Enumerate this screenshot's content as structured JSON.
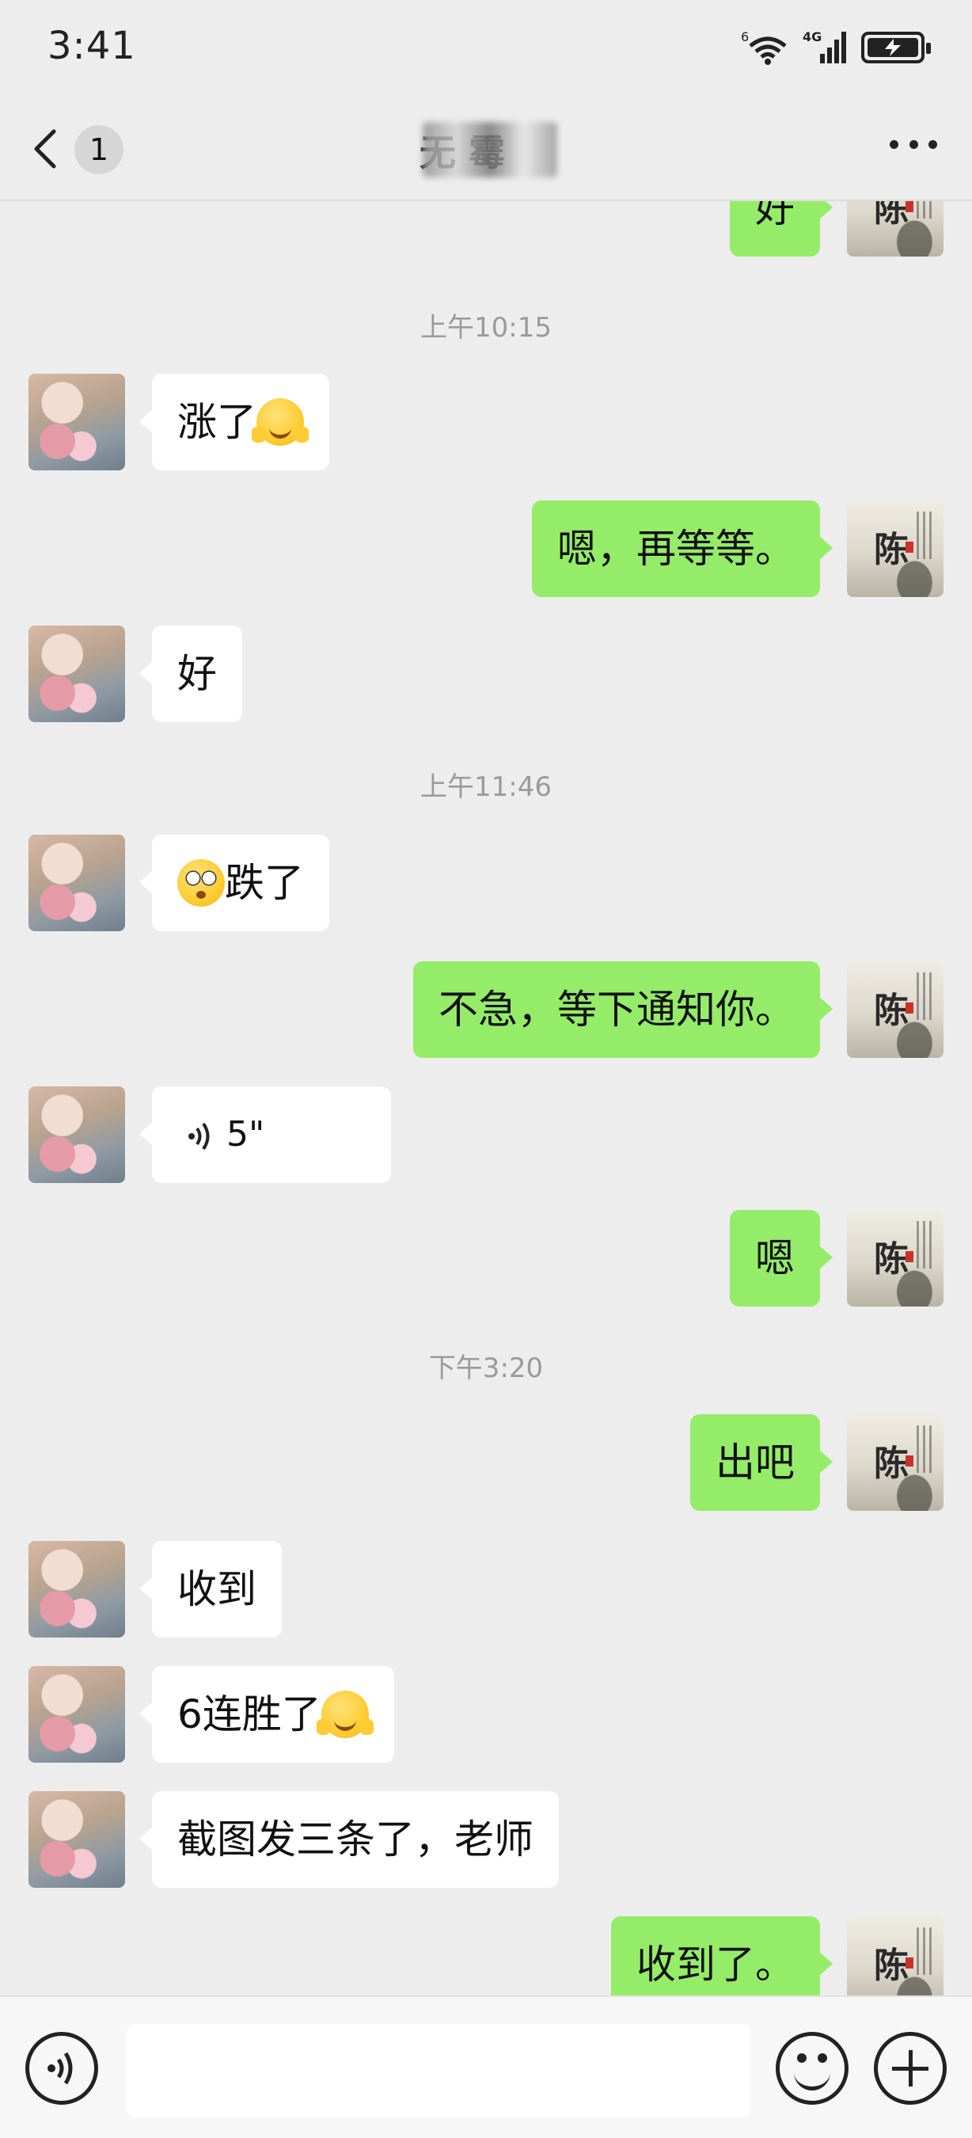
{
  "status_bar": {
    "time": "3:41",
    "wifi_label": "6",
    "network_label": "4G"
  },
  "nav": {
    "unread_count": "1",
    "title": "无 霉"
  },
  "timestamps": {
    "t1": "上午10:15",
    "t2": "上午11:46",
    "t3": "下午3:20"
  },
  "messages": [
    {
      "side": "right",
      "text": "好"
    },
    {
      "side": "left",
      "text": "涨了",
      "emoji": "hugging-face-emoji"
    },
    {
      "side": "right",
      "text": "嗯，再等等。"
    },
    {
      "side": "left",
      "text": "好"
    },
    {
      "side": "left",
      "text": "跌了",
      "emoji": "flushed-face-emoji"
    },
    {
      "side": "right",
      "text": "不急，等下通知你。"
    },
    {
      "side": "left",
      "type": "voice",
      "text": "5\""
    },
    {
      "side": "right",
      "text": "嗯"
    },
    {
      "side": "right",
      "text": "出吧"
    },
    {
      "side": "left",
      "text": "收到"
    },
    {
      "side": "left",
      "text": "6连胜了",
      "emoji": "hugging-face-emoji"
    },
    {
      "side": "left",
      "text": "截图发三条了，老师"
    },
    {
      "side": "right",
      "text": "收到了。"
    }
  ],
  "avatars": {
    "self_char": "陈"
  },
  "input": {
    "placeholder": ""
  }
}
